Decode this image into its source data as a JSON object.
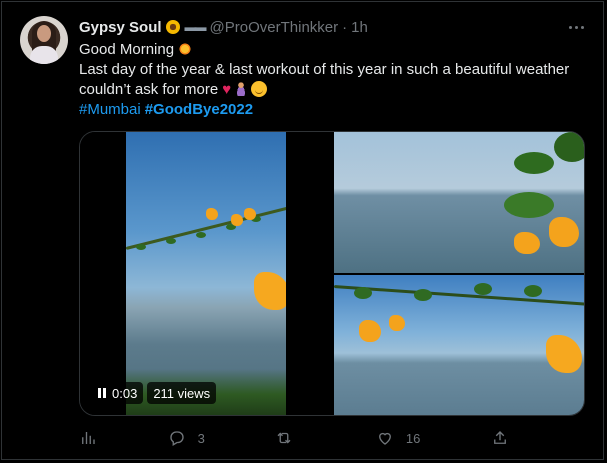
{
  "tweet": {
    "display_name": "Gypsy Soul",
    "handle": "@ProOverThinkker",
    "separator": "·",
    "time": "1h",
    "line1": "Good Morning",
    "line2": "Last day of the year & last workout of this year in such a beautiful weather",
    "line3": "couldn’t ask for more",
    "hashtags": [
      "#Mumbai",
      "#GoodBye2022"
    ]
  },
  "video": {
    "time": "0:03",
    "views": "211 views"
  },
  "actions": {
    "analytics_icon": "bar-chart-icon",
    "replies": "3",
    "retweets": "",
    "likes": "16",
    "share_icon": "share-icon"
  },
  "colors": {
    "background": "#000000",
    "text": "#e7e9ea",
    "muted": "#71767b",
    "link": "#1d9bf0",
    "border": "#2f3336"
  }
}
